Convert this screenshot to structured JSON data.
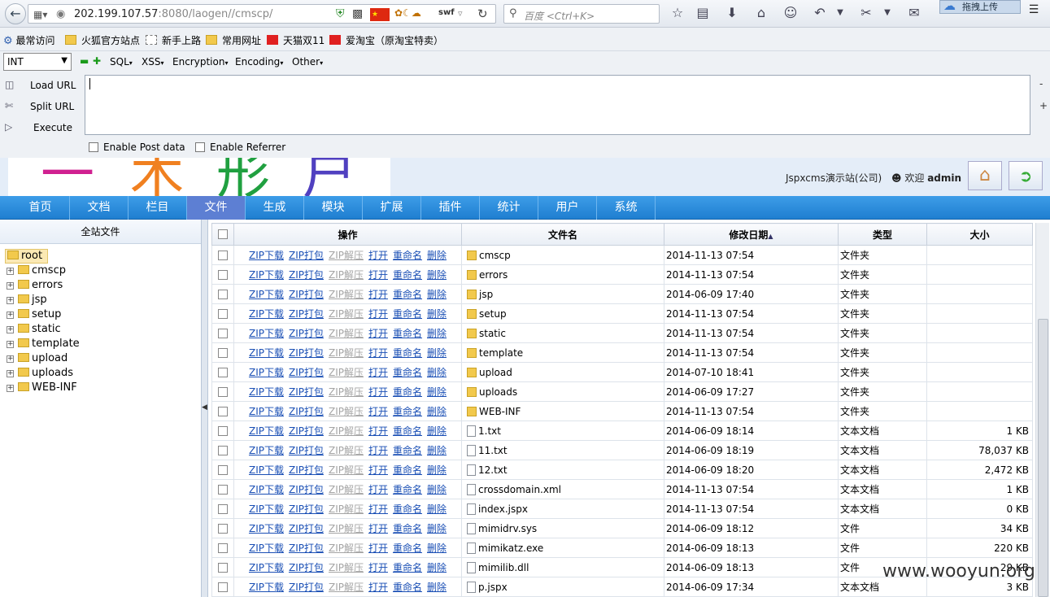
{
  "browser": {
    "url_host": "202.199.107.57",
    "url_rest": ":8080/laogen//cmscp/",
    "search_placeholder": "百度 <Ctrl+K>",
    "flag_text": "★",
    "swf_label": "swf",
    "upload_button": "拖拽上传",
    "bookmarks": [
      {
        "label": "最常访问",
        "icon": "gear-blue"
      },
      {
        "label": "火狐官方站点",
        "icon": "folder"
      },
      {
        "label": "新手上路",
        "icon": "dashed"
      },
      {
        "label": "常用网址",
        "icon": "folder"
      },
      {
        "label": "天猫双11",
        "icon": "red"
      },
      {
        "label": "爱淘宝（原淘宝特卖）",
        "icon": "red"
      }
    ]
  },
  "hackbar": {
    "select_value": "INT",
    "menus": [
      "SQL",
      "XSS",
      "Encryption",
      "Encoding",
      "Other"
    ],
    "load_url": "Load URL",
    "split_url": "Split URL",
    "execute": "Execute",
    "textarea_value": "",
    "enable_post": "Enable Post data",
    "enable_referrer": "Enable Referrer"
  },
  "header": {
    "site_name": "Jspxcms演示站(公司)",
    "welcome": "欢迎",
    "user": "admin"
  },
  "nav": [
    "首页",
    "文档",
    "栏目",
    "文件",
    "生成",
    "模块",
    "扩展",
    "插件",
    "统计",
    "用户",
    "系统"
  ],
  "nav_active": 3,
  "sidebar": {
    "title": "全站文件",
    "root": "root",
    "nodes": [
      "cmscp",
      "errors",
      "jsp",
      "setup",
      "static",
      "template",
      "upload",
      "uploads",
      "WEB-INF"
    ]
  },
  "table": {
    "headers": {
      "ops": "操作",
      "name": "文件名",
      "modified": "修改日期",
      "type": "类型",
      "size": "大小"
    },
    "op_labels": [
      "ZIP下载",
      "ZIP打包",
      "ZIP解压",
      "打开",
      "重命名",
      "删除"
    ],
    "rows": [
      {
        "name": "cmscp",
        "modified": "2014-11-13 07:54",
        "type": "文件夹",
        "size": "",
        "dir": true
      },
      {
        "name": "errors",
        "modified": "2014-11-13 07:54",
        "type": "文件夹",
        "size": "",
        "dir": true
      },
      {
        "name": "jsp",
        "modified": "2014-06-09 17:40",
        "type": "文件夹",
        "size": "",
        "dir": true
      },
      {
        "name": "setup",
        "modified": "2014-11-13 07:54",
        "type": "文件夹",
        "size": "",
        "dir": true
      },
      {
        "name": "static",
        "modified": "2014-11-13 07:54",
        "type": "文件夹",
        "size": "",
        "dir": true
      },
      {
        "name": "template",
        "modified": "2014-11-13 07:54",
        "type": "文件夹",
        "size": "",
        "dir": true
      },
      {
        "name": "upload",
        "modified": "2014-07-10 18:41",
        "type": "文件夹",
        "size": "",
        "dir": true
      },
      {
        "name": "uploads",
        "modified": "2014-06-09 17:27",
        "type": "文件夹",
        "size": "",
        "dir": true
      },
      {
        "name": "WEB-INF",
        "modified": "2014-11-13 07:54",
        "type": "文件夹",
        "size": "",
        "dir": true
      },
      {
        "name": "1.txt",
        "modified": "2014-06-09 18:14",
        "type": "文本文档",
        "size": "1 KB",
        "dir": false
      },
      {
        "name": "11.txt",
        "modified": "2014-06-09 18:19",
        "type": "文本文档",
        "size": "78,037 KB",
        "dir": false
      },
      {
        "name": "12.txt",
        "modified": "2014-06-09 18:20",
        "type": "文本文档",
        "size": "2,472 KB",
        "dir": false
      },
      {
        "name": "crossdomain.xml",
        "modified": "2014-11-13 07:54",
        "type": "文本文档",
        "size": "1 KB",
        "dir": false
      },
      {
        "name": "index.jspx",
        "modified": "2014-11-13 07:54",
        "type": "文本文档",
        "size": "0 KB",
        "dir": false
      },
      {
        "name": "mimidrv.sys",
        "modified": "2014-06-09 18:12",
        "type": "文件",
        "size": "34 KB",
        "dir": false
      },
      {
        "name": "mimikatz.exe",
        "modified": "2014-06-09 18:13",
        "type": "文件",
        "size": "220 KB",
        "dir": false
      },
      {
        "name": "mimilib.dll",
        "modified": "2014-06-09 18:13",
        "type": "文件",
        "size": "29 KB",
        "dir": false
      },
      {
        "name": "p.jspx",
        "modified": "2014-06-09 17:34",
        "type": "文本文档",
        "size": "3 KB",
        "dir": false
      }
    ]
  },
  "watermark": "www.wooyun.org",
  "colors": {
    "nav_bg": "#2a8ad9",
    "nav_active": "#5d7fd3",
    "link": "#1a4fb5",
    "disabled_link": "#a4a4a4"
  }
}
